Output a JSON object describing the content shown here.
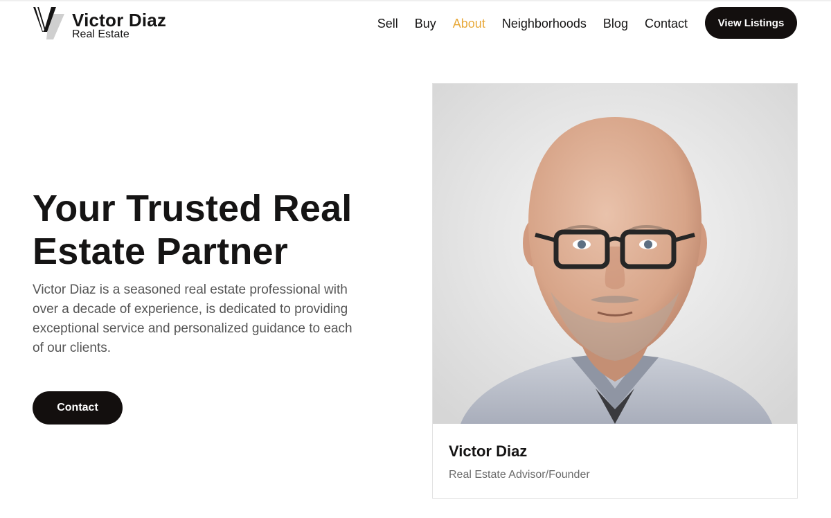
{
  "brand": {
    "name": "Victor Diaz",
    "subtitle": "Real Estate"
  },
  "nav": {
    "items": [
      {
        "label": "Sell"
      },
      {
        "label": "Buy"
      },
      {
        "label": "About",
        "active": true
      },
      {
        "label": "Neighborhoods"
      },
      {
        "label": "Blog"
      },
      {
        "label": "Contact"
      }
    ],
    "cta_label": "View Listings",
    "active_color": "#e8a93a"
  },
  "hero": {
    "title": "Your Trusted Real Estate Partner",
    "description": "Victor Diaz is a seasoned real estate professional with over a decade of experience, is dedicated to providing exceptional service and personalized guidance to each of our clients.",
    "button_label": "Contact"
  },
  "profile": {
    "name": "Victor Diaz",
    "role": "Real Estate Advisor/Founder"
  },
  "colors": {
    "button_bg": "#130f0e",
    "text": "#151414"
  }
}
